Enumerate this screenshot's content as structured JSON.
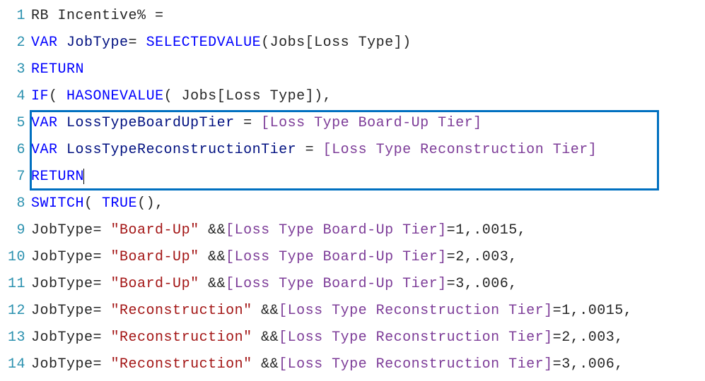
{
  "lines": {
    "l1": {
      "num": "1",
      "ident": "RB Incentive%",
      "op": "="
    },
    "l2": {
      "num": "2",
      "var": "VAR",
      "name": "JobType",
      "eq": "=",
      "func": "SELECTEDVALUE",
      "paren_open": "(",
      "arg": "Jobs[Loss Type]",
      "paren_close": ")"
    },
    "l3": {
      "num": "3",
      "ret": "RETURN"
    },
    "l4": {
      "num": "4",
      "if": "IF",
      "po": "(",
      "sp": " ",
      "func": "HASONEVALUE",
      "po2": "(",
      "sp2": " ",
      "arg": "Jobs[Loss Type]",
      "pc": ")",
      "comma": ","
    },
    "l5": {
      "num": "5",
      "var": "VAR",
      "name": "LossTypeBoardUpTier",
      "eq": "=",
      "ref": "[Loss Type Board-Up Tier]"
    },
    "l6": {
      "num": "6",
      "var": "VAR",
      "name": "LossTypeReconstructionTier",
      "eq": "=",
      "ref": "[Loss Type Reconstruction Tier]"
    },
    "l7": {
      "num": "7",
      "ret": "RETURN"
    },
    "l8": {
      "num": "8",
      "func": "SWITCH",
      "po": "(",
      "sp": " ",
      "t": "TRUE",
      "pc": "()",
      "comma": ","
    },
    "l9": {
      "num": "9",
      "lhs": "JobType",
      "eq": "=",
      "str": "\"Board-Up\"",
      "amp": "&&",
      "ref": "[Loss Type Board-Up Tier]",
      "eq2": "=",
      "n1": "1",
      "c": ",",
      "n2": ".0015",
      "c2": ","
    },
    "l10": {
      "num": "10",
      "lhs": "JobType",
      "eq": "=",
      "str": "\"Board-Up\"",
      "amp": "&&",
      "ref": "[Loss Type Board-Up Tier]",
      "eq2": "=",
      "n1": "2",
      "c": ",",
      "n2": ".003",
      "c2": ","
    },
    "l11": {
      "num": "11",
      "lhs": "JobType",
      "eq": "=",
      "str": "\"Board-Up\"",
      "amp": "&&",
      "ref": "[Loss Type Board-Up Tier]",
      "eq2": "=",
      "n1": "3",
      "c": ",",
      "n2": ".006",
      "c2": ","
    },
    "l12": {
      "num": "12",
      "lhs": "JobType",
      "eq": "=",
      "str": "\"Reconstruction\"",
      "amp": "&&",
      "ref": "[Loss Type Reconstruction Tier]",
      "eq2": "=",
      "n1": "1",
      "c": ",",
      "n2": ".0015",
      "c2": ","
    },
    "l13": {
      "num": "13",
      "lhs": "JobType",
      "eq": "=",
      "str": "\"Reconstruction\"",
      "amp": "&&",
      "ref": "[Loss Type Reconstruction Tier]",
      "eq2": "=",
      "n1": "2",
      "c": ",",
      "n2": ".003",
      "c2": ","
    },
    "l14": {
      "num": "14",
      "lhs": "JobType",
      "eq": "=",
      "str": "\"Reconstruction\"",
      "amp": "&&",
      "ref": "[Loss Type Reconstruction Tier]",
      "eq2": "=",
      "n1": "3",
      "c": ",",
      "n2": ".006",
      "c2": ","
    }
  }
}
